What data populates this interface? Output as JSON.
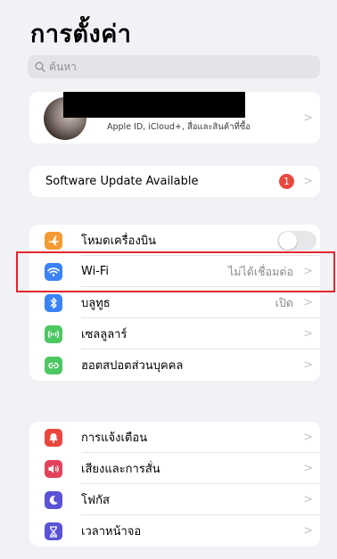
{
  "header": {
    "title": "การตั้งค่า"
  },
  "search": {
    "placeholder": "ค้นหา"
  },
  "profile": {
    "subtitle": "Apple ID, iCloud+, สื่อและสินค้าที่ซื้อ"
  },
  "software_update": {
    "label": "Software Update Available",
    "badge": "1"
  },
  "connectivity": [
    {
      "label": "โหมดเครื่องบิน",
      "icon": "airplane-icon",
      "color": "#f49a33",
      "toggle": "off"
    },
    {
      "label": "Wi-Fi",
      "value": "ไม่ได้เชื่อมต่อ",
      "icon": "wifi-icon",
      "color": "#3a82f6"
    },
    {
      "label": "บลูทูธ",
      "value": "เปิด",
      "icon": "bluetooth-icon",
      "color": "#3a82f6"
    },
    {
      "label": "เซลลูลาร์",
      "icon": "cellular-icon",
      "color": "#4cc761"
    },
    {
      "label": "ฮอตสปอตส่วนบุคคล",
      "icon": "hotspot-icon",
      "color": "#4cc761"
    }
  ],
  "notifications": [
    {
      "label": "การแจ้งเตือน",
      "icon": "notification-bell-icon",
      "color": "#e9463f"
    },
    {
      "label": "เสียงและการสั่น",
      "icon": "speaker-icon",
      "color": "#e4425b"
    },
    {
      "label": "โฟกัส",
      "icon": "moon-icon",
      "color": "#5a53d6"
    },
    {
      "label": "เวลาหน้าจอ",
      "icon": "hourglass-icon",
      "color": "#5a53d6"
    }
  ],
  "chevron": ">",
  "colors": {
    "highlight_border": "#e3262c",
    "badge": "#e8493f"
  }
}
